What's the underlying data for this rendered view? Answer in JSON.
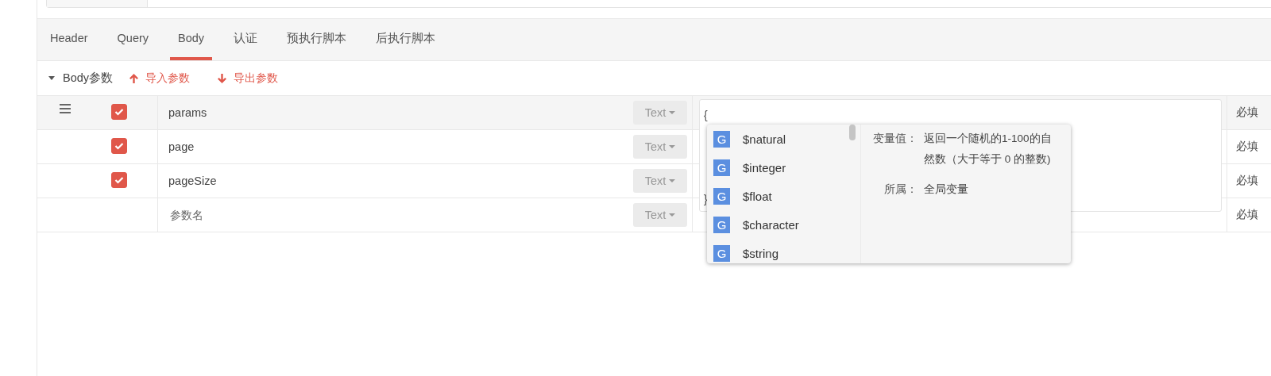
{
  "tabs": [
    {
      "label": "Header",
      "selected": false
    },
    {
      "label": "Query",
      "selected": false
    },
    {
      "label": "Body",
      "selected": true
    },
    {
      "label": "认证",
      "selected": false
    },
    {
      "label": "预执行脚本",
      "selected": false
    },
    {
      "label": "后执行脚本",
      "selected": false
    }
  ],
  "section": {
    "title": "Body参数",
    "expanded": true,
    "import_label": "导入参数",
    "export_label": "导出参数"
  },
  "rows": [
    {
      "kind": "param",
      "name": "params",
      "checked": true,
      "selected": true,
      "type": "Text",
      "required": "必填"
    },
    {
      "kind": "param",
      "name": "page",
      "checked": true,
      "selected": false,
      "type": "Text",
      "required": "必填"
    },
    {
      "kind": "param",
      "name": "pageSize",
      "checked": true,
      "selected": false,
      "type": "Text",
      "required": "必填"
    },
    {
      "kind": "new",
      "placeholder": "参数名",
      "type": "Text",
      "required": "必填"
    }
  ],
  "editor": {
    "lines": [
      "{",
      "}"
    ]
  },
  "suggestions": {
    "items": [
      {
        "badge": "G",
        "label": "$natural"
      },
      {
        "badge": "G",
        "label": "$integer"
      },
      {
        "badge": "G",
        "label": "$float"
      },
      {
        "badge": "G",
        "label": "$character"
      },
      {
        "badge": "G",
        "label": "$string"
      }
    ],
    "details": [
      {
        "label": "变量值：",
        "value": "返回一个随机的1-100的自然数（大于等于 0 的整数)"
      },
      {
        "label": "所属：",
        "value": "全局变量"
      }
    ]
  }
}
